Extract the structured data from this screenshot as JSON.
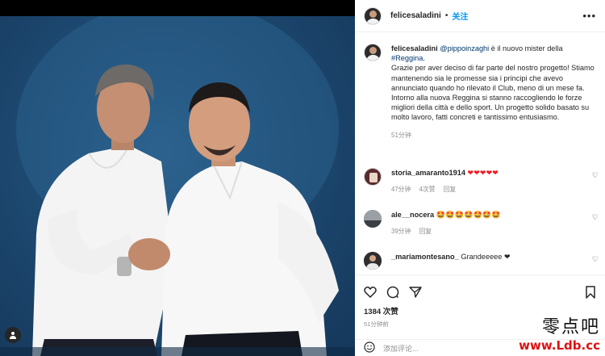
{
  "post": {
    "username": "felicesaladini",
    "follow_label": "关注",
    "caption_user": "felicesaladini",
    "caption_mention": "@pippoinzaghi",
    "caption_line1": " è il nuovo mister della",
    "caption_hashtag": "#Reggina",
    "caption_line2": ".",
    "caption_body": "Grazie per aver deciso di far parte del nostro progetto! Stiamo mantenendo sia le promesse sia i principi che avevo annunciato quando ho rilevato il Club, meno di un mese fa. Intorno alla nuova Reggina si stanno raccogliendo le forze migliori della città e dello sport. Un progetto solido basato su molto lavoro, fatti concreti e tantissimo entusiasmo.",
    "caption_time": "51分钟",
    "likes": "1384 次赞",
    "posted_time": "51分钟前",
    "add_comment_placeholder": "添加评论..."
  },
  "comments": [
    {
      "user": "storia_amaranto1914",
      "text": "❤❤❤❤❤",
      "time": "47分钟",
      "likes": "4次赞",
      "reply": "回复"
    },
    {
      "user": "ale__nocera",
      "text": "🤩🤩🤩🤩🤩🤩🤩",
      "time": "39分钟",
      "reply": "回复"
    },
    {
      "user": "_mariamontesano_",
      "text": "Grandeeeee ❤"
    }
  ],
  "watermark": {
    "cn": "零点吧",
    "url": "www.Ldb.cc"
  },
  "colors": {
    "link": "#0095f6",
    "muted": "#8e8e8e",
    "photo_bg": "#1e4a72"
  }
}
